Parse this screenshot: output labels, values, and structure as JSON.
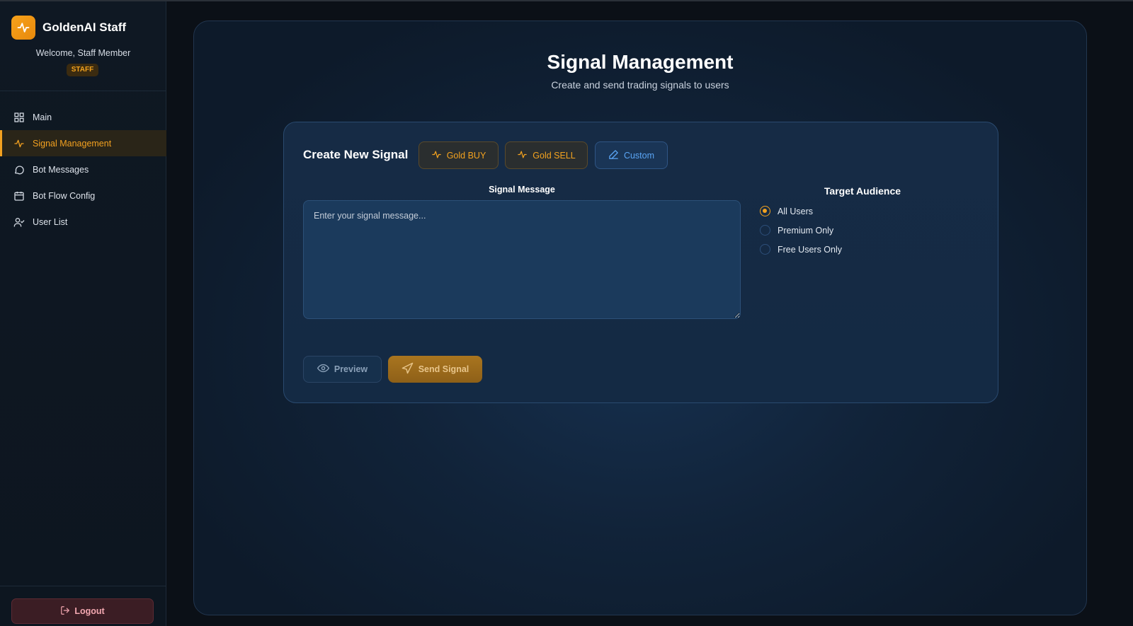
{
  "sidebar": {
    "brand_title": "GoldenAI Staff",
    "welcome": "Welcome, Staff Member",
    "role_badge": "STAFF",
    "items": [
      {
        "label": "Main",
        "icon": "grid-icon",
        "active": false
      },
      {
        "label": "Signal Management",
        "icon": "activity-icon",
        "active": true
      },
      {
        "label": "Bot Messages",
        "icon": "chat-bubble-icon",
        "active": false
      },
      {
        "label": "Bot Flow Config",
        "icon": "calendar-icon",
        "active": false
      },
      {
        "label": "User List",
        "icon": "user-check-icon",
        "active": false
      }
    ],
    "logout_label": "Logout"
  },
  "main": {
    "title": "Signal Management",
    "subtitle": "Create and send trading signals to users",
    "card": {
      "title": "Create New Signal",
      "templates": [
        {
          "label": "Gold BUY",
          "icon": "activity-icon"
        },
        {
          "label": "Gold SELL",
          "icon": "activity-icon"
        },
        {
          "label": "Custom",
          "icon": "pen-icon",
          "selected": true
        }
      ],
      "message_label": "Signal Message",
      "message_value": "",
      "message_placeholder": "Enter your signal message...",
      "audience_title": "Target Audience",
      "audience_options": [
        {
          "label": "All Users",
          "checked": true
        },
        {
          "label": "Premium Only",
          "checked": false
        },
        {
          "label": "Free Users Only",
          "checked": false
        }
      ],
      "preview_label": "Preview",
      "send_label": "Send Signal"
    }
  },
  "colors": {
    "accent": "#f3a21f",
    "custom_blue": "#5aa5f5",
    "panel_bg": "#112339",
    "logout_text": "#f2a7b0"
  }
}
